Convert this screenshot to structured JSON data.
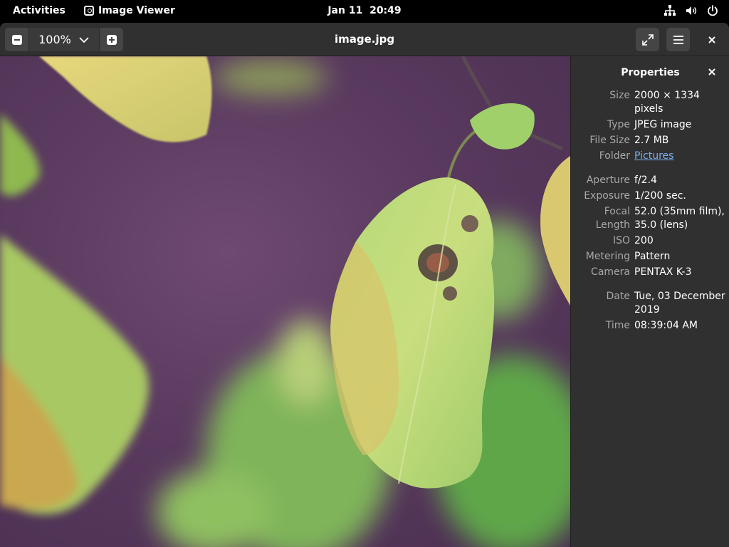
{
  "topbar": {
    "activities": "Activities",
    "app_name": "Image Viewer",
    "date": "Jan 11",
    "time": "20:49"
  },
  "header": {
    "zoom": "100%",
    "title": "image.jpg"
  },
  "sidebar": {
    "title": "Properties",
    "groups": [
      [
        {
          "key": "Size",
          "value": "2000 × 1334 pixels"
        },
        {
          "key": "Type",
          "value": "JPEG image"
        },
        {
          "key": "File Size",
          "value": "2.7 MB"
        },
        {
          "key": "Folder",
          "value": "Pictures"
        }
      ],
      [
        {
          "key": "Aperture",
          "value": "f/2.4"
        },
        {
          "key": "Exposure",
          "value": "1/200 sec."
        },
        {
          "key": "Focal Length",
          "value": "52.0 (35mm film), 35.0 (lens)"
        },
        {
          "key": "ISO",
          "value": "200"
        },
        {
          "key": "Metering",
          "value": "Pattern"
        },
        {
          "key": "Camera",
          "value": "PENTAX K-3"
        }
      ],
      [
        {
          "key": "Date",
          "value": "Tue, 03 December 2019"
        },
        {
          "key": "Time",
          "value": "08:39:04 AM"
        }
      ]
    ]
  },
  "colors": {
    "accent_link": "#78aeed",
    "headerbar": "#303030",
    "sidebar": "#303030"
  }
}
